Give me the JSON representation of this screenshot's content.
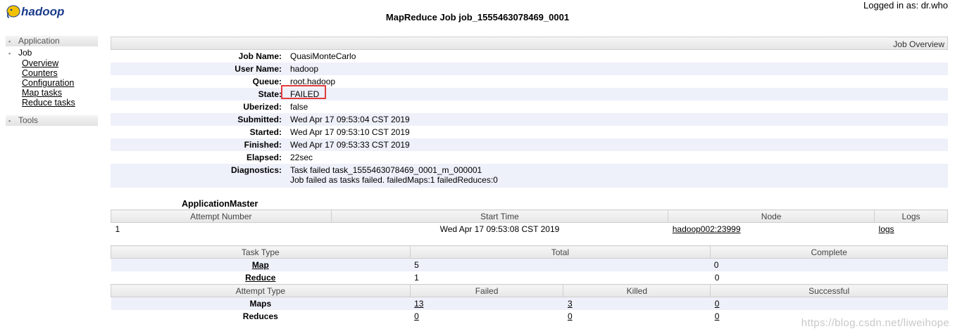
{
  "header": {
    "logo_text": "hadoop",
    "title": "MapReduce Job job_1555463078469_0001",
    "logged_in": "Logged in as: dr.who"
  },
  "sidebar": {
    "application": "Application",
    "job": "Job",
    "links": [
      "Overview",
      "Counters",
      "Configuration",
      "Map tasks",
      "Reduce tasks"
    ],
    "tools": "Tools"
  },
  "overview": {
    "header": "Job Overview",
    "rows": [
      {
        "label": "Job Name:",
        "value": "QuasiMonteCarlo"
      },
      {
        "label": "User Name:",
        "value": "hadoop"
      },
      {
        "label": "Queue:",
        "value": "root.hadoop"
      },
      {
        "label": "State:",
        "value": "FAILED"
      },
      {
        "label": "Uberized:",
        "value": "false"
      },
      {
        "label": "Submitted:",
        "value": "Wed Apr 17 09:53:04 CST 2019"
      },
      {
        "label": "Started:",
        "value": "Wed Apr 17 09:53:10 CST 2019"
      },
      {
        "label": "Finished:",
        "value": "Wed Apr 17 09:53:33 CST 2019"
      },
      {
        "label": "Elapsed:",
        "value": "22sec"
      }
    ],
    "diagnostics": {
      "label": "Diagnostics:",
      "line1": "Task failed task_1555463078469_0001_m_000001",
      "line2": "Job failed as tasks failed. failedMaps:1 failedReduces:0"
    }
  },
  "app_master": {
    "caption": "ApplicationMaster",
    "headers": [
      "Attempt Number",
      "Start Time",
      "Node",
      "Logs"
    ],
    "row": {
      "attempt": "1",
      "start_time": "Wed Apr 17 09:53:08 CST 2019",
      "node": "hadoop002:23999",
      "logs": "logs"
    }
  },
  "tasks": {
    "headers": [
      "Task Type",
      "Total",
      "Complete"
    ],
    "rows": [
      {
        "type": "Map",
        "total": "5",
        "complete": "0"
      },
      {
        "type": "Reduce",
        "total": "1",
        "complete": "0"
      }
    ]
  },
  "attempts": {
    "headers": [
      "Attempt Type",
      "Failed",
      "Killed",
      "Successful"
    ],
    "rows": [
      {
        "type": "Maps",
        "failed": "13",
        "killed": "3",
        "successful": "0"
      },
      {
        "type": "Reduces",
        "failed": "0",
        "killed": "0",
        "successful": "0"
      }
    ]
  },
  "watermark": "https://blog.csdn.net/liweihope"
}
